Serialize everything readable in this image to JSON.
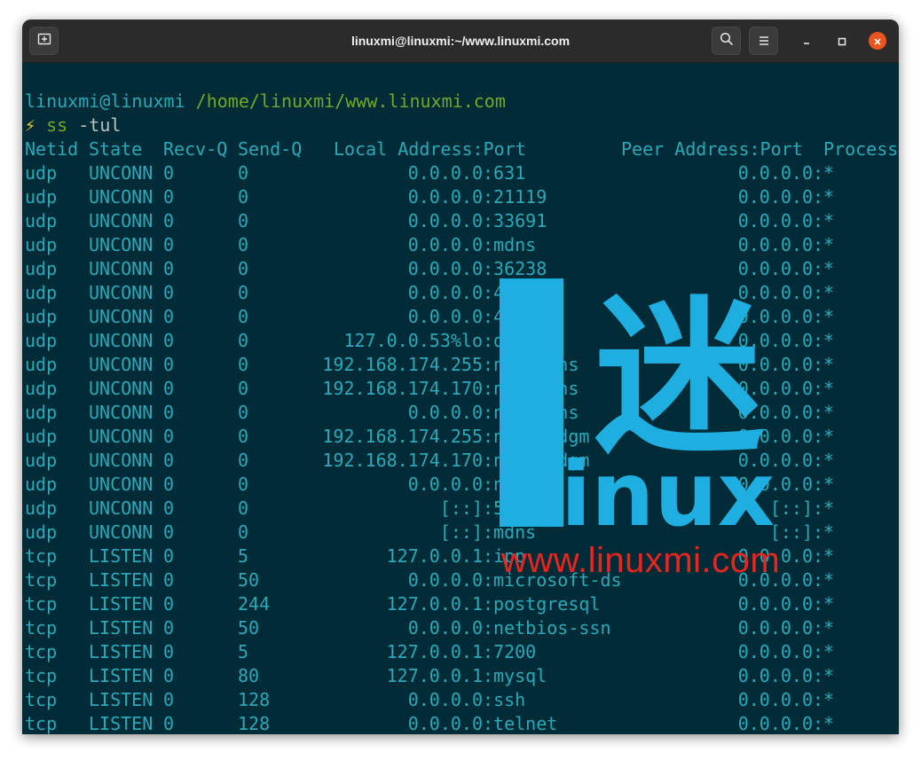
{
  "window": {
    "title": "linuxmi@linuxmi:~/www.linuxmi.com",
    "icons": {
      "new_tab": "new-tab-icon",
      "search": "search-icon",
      "menu": "hamburger-menu-icon",
      "minimize": "minimize-icon",
      "maximize": "maximize-icon",
      "close": "close-icon"
    },
    "colors": {
      "close": "#e95420",
      "background": "#012b36",
      "text": "#2aa9b9",
      "path": "#74a72a"
    }
  },
  "terminal": {
    "prompt_user": "linuxmi@linuxmi",
    "prompt_path": "/home/linuxmi/www.linuxmi.com",
    "prompt_symbol": "⚡",
    "command": "ss",
    "command_args": "-tul",
    "headers": [
      "Netid",
      "State",
      "Recv-Q",
      "Send-Q",
      "Local Address:Port",
      "Peer Address:Port",
      "Process"
    ],
    "rows": [
      {
        "netid": "udp",
        "state": "UNCONN",
        "recvq": "0",
        "sendq": "0",
        "local": "0.0.0.0",
        "lport": ":631",
        "peer": "0.0.0.0",
        "pport": ":*"
      },
      {
        "netid": "udp",
        "state": "UNCONN",
        "recvq": "0",
        "sendq": "0",
        "local": "0.0.0.0",
        "lport": ":21119",
        "peer": "0.0.0.0",
        "pport": ":*"
      },
      {
        "netid": "udp",
        "state": "UNCONN",
        "recvq": "0",
        "sendq": "0",
        "local": "0.0.0.0",
        "lport": ":33691",
        "peer": "0.0.0.0",
        "pport": ":*"
      },
      {
        "netid": "udp",
        "state": "UNCONN",
        "recvq": "0",
        "sendq": "0",
        "local": "0.0.0.0",
        "lport": ":mdns",
        "peer": "0.0.0.0",
        "pport": ":*"
      },
      {
        "netid": "udp",
        "state": "UNCONN",
        "recvq": "0",
        "sendq": "0",
        "local": "0.0.0.0",
        "lport": ":36238",
        "peer": "0.0.0.0",
        "pport": ":*"
      },
      {
        "netid": "udp",
        "state": "UNCONN",
        "recvq": "0",
        "sendq": "0",
        "local": "0.0.0.0",
        "lport": ":46",
        "peer": "0.0.0.0",
        "pport": ":*"
      },
      {
        "netid": "udp",
        "state": "UNCONN",
        "recvq": "0",
        "sendq": "0",
        "local": "0.0.0.0",
        "lport": ":43",
        "peer": "0.0.0.0",
        "pport": ":*"
      },
      {
        "netid": "udp",
        "state": "UNCONN",
        "recvq": "0",
        "sendq": "0",
        "local": "127.0.0.53%lo",
        "lport": ":do",
        "peer": "0.0.0.0",
        "pport": ":*"
      },
      {
        "netid": "udp",
        "state": "UNCONN",
        "recvq": "0",
        "sendq": "0",
        "local": "192.168.174.255",
        "lport": ":ne    ns",
        "peer": "0.0.0.0",
        "pport": ":*"
      },
      {
        "netid": "udp",
        "state": "UNCONN",
        "recvq": "0",
        "sendq": "0",
        "local": "192.168.174.170",
        "lport": ":ne    ns",
        "peer": "0.0.0.0",
        "pport": ":*"
      },
      {
        "netid": "udp",
        "state": "UNCONN",
        "recvq": "0",
        "sendq": "0",
        "local": "0.0.0.0",
        "lport": ":ne    ns",
        "peer": "0.0.0.0",
        "pport": ":*"
      },
      {
        "netid": "udp",
        "state": "UNCONN",
        "recvq": "0",
        "sendq": "0",
        "local": "192.168.174.255",
        "lport": ":ne    dgm",
        "peer": "0.0.0.0",
        "pport": ":*"
      },
      {
        "netid": "udp",
        "state": "UNCONN",
        "recvq": "0",
        "sendq": "0",
        "local": "192.168.174.170",
        "lport": ":ne    dgm",
        "peer": "0.0.0.0",
        "pport": ":*"
      },
      {
        "netid": "udp",
        "state": "UNCONN",
        "recvq": "0",
        "sendq": "0",
        "local": "0.0.0.0",
        "lport": ":ne",
        "peer": "0.0.0.0",
        "pport": ":*"
      },
      {
        "netid": "udp",
        "state": "UNCONN",
        "recvq": "0",
        "sendq": "0",
        "local": "[::]",
        "lport": ":54",
        "peer": "[::]",
        "pport": ":*"
      },
      {
        "netid": "udp",
        "state": "UNCONN",
        "recvq": "0",
        "sendq": "0",
        "local": "[::]",
        "lport": ":mdns",
        "peer": "[::]",
        "pport": ":*"
      },
      {
        "netid": "tcp",
        "state": "LISTEN",
        "recvq": "0",
        "sendq": "5",
        "local": "127.0.0.1",
        "lport": ":ipp",
        "peer": "0.0.0.0",
        "pport": ":*"
      },
      {
        "netid": "tcp",
        "state": "LISTEN",
        "recvq": "0",
        "sendq": "50",
        "local": "0.0.0.0",
        "lport": ":microsoft-ds",
        "peer": "0.0.0.0",
        "pport": ":*"
      },
      {
        "netid": "tcp",
        "state": "LISTEN",
        "recvq": "0",
        "sendq": "244",
        "local": "127.0.0.1",
        "lport": ":postgresql",
        "peer": "0.0.0.0",
        "pport": ":*"
      },
      {
        "netid": "tcp",
        "state": "LISTEN",
        "recvq": "0",
        "sendq": "50",
        "local": "0.0.0.0",
        "lport": ":netbios-ssn",
        "peer": "0.0.0.0",
        "pport": ":*"
      },
      {
        "netid": "tcp",
        "state": "LISTEN",
        "recvq": "0",
        "sendq": "5",
        "local": "127.0.0.1",
        "lport": ":7200",
        "peer": "0.0.0.0",
        "pport": ":*"
      },
      {
        "netid": "tcp",
        "state": "LISTEN",
        "recvq": "0",
        "sendq": "80",
        "local": "127.0.0.1",
        "lport": ":mysql",
        "peer": "0.0.0.0",
        "pport": ":*"
      },
      {
        "netid": "tcp",
        "state": "LISTEN",
        "recvq": "0",
        "sendq": "128",
        "local": "0.0.0.0",
        "lport": ":ssh",
        "peer": "0.0.0.0",
        "pport": ":*"
      },
      {
        "netid": "tcp",
        "state": "LISTEN",
        "recvq": "0",
        "sendq": "128",
        "local": "0.0.0.0",
        "lport": ":telnet",
        "peer": "0.0.0.0",
        "pport": ":*"
      }
    ]
  },
  "watermark": {
    "logo_letter": "L",
    "logo_char": "迷",
    "logo_word": "inux",
    "url": "www.linuxmi.com",
    "colors": {
      "logo": "#1eaee0",
      "url": "#e8251e"
    }
  }
}
